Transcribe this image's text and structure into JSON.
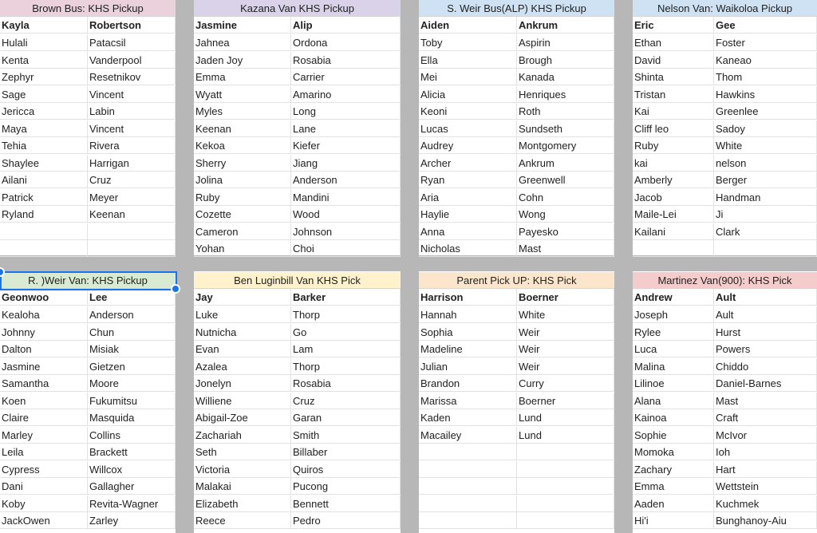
{
  "blocks": [
    {
      "id": "brown-bus",
      "title": "Brown Bus: KHS Pickup",
      "color": "#ead1dc",
      "head": [
        "Kayla",
        "Robertson"
      ],
      "rows": [
        [
          "Hulali",
          "Patacsil"
        ],
        [
          "Kenta",
          "Vanderpool"
        ],
        [
          "Zephyr",
          "Resetnikov"
        ],
        [
          "Sage",
          "Vincent"
        ],
        [
          "Jericca",
          "Labin"
        ],
        [
          "Maya",
          "Vincent"
        ],
        [
          "Tehia",
          "Rivera"
        ],
        [
          "Shaylee",
          "Harrigan"
        ],
        [
          "Ailani",
          "Cruz"
        ],
        [
          "Patrick",
          "Meyer"
        ],
        [
          "Ryland",
          "Keenan"
        ],
        [
          "",
          ""
        ],
        [
          "",
          ""
        ]
      ]
    },
    {
      "id": "kazana-van",
      "title": "Kazana Van KHS Pickup",
      "color": "#d9d2e9",
      "head": [
        "Jasmine",
        "Alip"
      ],
      "rows": [
        [
          "Jahnea",
          "Ordona"
        ],
        [
          "Jaden Joy",
          "Rosabia"
        ],
        [
          "Emma",
          "Carrier"
        ],
        [
          "Wyatt",
          "Amarino"
        ],
        [
          "Myles",
          "Long"
        ],
        [
          "Keenan",
          "Lane"
        ],
        [
          "Kekoa",
          "Kiefer"
        ],
        [
          "Sherry",
          "Jiang"
        ],
        [
          "Jolina",
          "Anderson"
        ],
        [
          "Ruby",
          "Mandini"
        ],
        [
          "Cozette",
          "Wood"
        ],
        [
          "Cameron",
          "Johnson"
        ],
        [
          "Yohan",
          "Choi"
        ]
      ]
    },
    {
      "id": "weir-bus",
      "title": "S. Weir Bus(ALP) KHS Pickup",
      "color": "#cfe2f3",
      "head": [
        "Aiden",
        "Ankrum"
      ],
      "rows": [
        [
          "Toby",
          "Aspirin"
        ],
        [
          "Ella",
          "Brough"
        ],
        [
          "Mei",
          "Kanada"
        ],
        [
          "Alicia",
          "Henriques"
        ],
        [
          "Keoni",
          "Roth"
        ],
        [
          "Lucas",
          "Sundseth"
        ],
        [
          "Audrey",
          "Montgomery"
        ],
        [
          "Archer",
          "Ankrum"
        ],
        [
          "Ryan",
          "Greenwell"
        ],
        [
          "Aria",
          "Cohn"
        ],
        [
          "Haylie",
          "Wong"
        ],
        [
          "Anna",
          "Payesko"
        ],
        [
          "Nicholas",
          "Mast"
        ]
      ]
    },
    {
      "id": "nelson-van",
      "title": "Nelson Van: Waikoloa Pickup",
      "color": "#cfe2f3",
      "head": [
        "Eric",
        "Gee"
      ],
      "rows": [
        [
          "Ethan",
          "Foster"
        ],
        [
          "David",
          "Kaneao"
        ],
        [
          "Shinta",
          "Thom"
        ],
        [
          "Tristan",
          "Hawkins"
        ],
        [
          "Kai",
          "Greenlee"
        ],
        [
          "Cliff leo",
          "Sadoy"
        ],
        [
          "Ruby",
          "White"
        ],
        [
          "kai",
          "nelson"
        ],
        [
          "Amberly",
          "Berger"
        ],
        [
          "Jacob",
          "Handman"
        ],
        [
          "Maile-Lei",
          "Ji"
        ],
        [
          "Kailani",
          "Clark"
        ],
        [
          "",
          ""
        ]
      ]
    },
    {
      "id": "r-weir-van",
      "title": "R. )Weir Van: KHS Pickup",
      "color": "#d9ead3",
      "head": [
        "Geonwoo",
        "Lee"
      ],
      "rows": [
        [
          "Kealoha",
          "Anderson"
        ],
        [
          "Johnny",
          "Chun"
        ],
        [
          "Dalton",
          "Misiak"
        ],
        [
          "Jasmine",
          "Gietzen"
        ],
        [
          "Samantha",
          "Moore"
        ],
        [
          "Koen",
          "Fukumitsu"
        ],
        [
          "Claire",
          "Masquida"
        ],
        [
          "Marley",
          "Collins"
        ],
        [
          "Leila",
          "Brackett"
        ],
        [
          "Cypress",
          "Willcox"
        ],
        [
          "Dani",
          "Gallagher"
        ],
        [
          "Koby",
          "Revita-Wagner"
        ],
        [
          "JackOwen",
          "Zarley"
        ]
      ]
    },
    {
      "id": "luginbill-van",
      "title": "Ben Luginbill Van KHS Pick",
      "color": "#fff2cc",
      "head": [
        "Jay",
        "Barker"
      ],
      "rows": [
        [
          "Luke",
          "Thorp"
        ],
        [
          "Nutnicha",
          "Go"
        ],
        [
          "Evan",
          "Lam"
        ],
        [
          "Azalea",
          "Thorp"
        ],
        [
          "Jonelyn",
          "Rosabia"
        ],
        [
          "Williene",
          "Cruz"
        ],
        [
          "Abigail-Zoe",
          "Garan"
        ],
        [
          "Zachariah",
          "Smith"
        ],
        [
          "Seth",
          "Billaber"
        ],
        [
          "Victoria",
          "Quiros"
        ],
        [
          "Malakai",
          "Pucong"
        ],
        [
          "Elizabeth",
          "Bennett"
        ],
        [
          "Reece",
          "Pedro"
        ]
      ]
    },
    {
      "id": "parent-pickup",
      "title": "Parent Pick UP: KHS Pick",
      "color": "#fce5cd",
      "head": [
        "Harrison",
        "Boerner"
      ],
      "rows": [
        [
          "Hannah",
          "White"
        ],
        [
          "Sophia",
          "Weir"
        ],
        [
          "Madeline",
          "Weir"
        ],
        [
          "Julian",
          "Weir"
        ],
        [
          "Brandon",
          "Curry"
        ],
        [
          "Marissa",
          "Boerner"
        ],
        [
          "Kaden",
          "Lund"
        ],
        [
          "Macailey",
          "Lund"
        ],
        [
          "",
          ""
        ],
        [
          "",
          ""
        ],
        [
          "",
          ""
        ],
        [
          "",
          ""
        ],
        [
          "",
          ""
        ]
      ]
    },
    {
      "id": "martinez-van",
      "title": "Martinez Van(900): KHS Pick",
      "color": "#f4cccc",
      "head": [
        "Andrew",
        "Ault"
      ],
      "rows": [
        [
          "Joseph",
          "Ault"
        ],
        [
          "Rylee",
          "Hurst"
        ],
        [
          "Luca",
          "Powers"
        ],
        [
          "Malina",
          "Chiddo"
        ],
        [
          "Lilinoe",
          "Daniel-Barnes"
        ],
        [
          "Alana",
          "Mast"
        ],
        [
          "Kainoa",
          "Craft"
        ],
        [
          "Sophie",
          "McIvor"
        ],
        [
          "Momoka",
          "Ioh"
        ],
        [
          "Zachary",
          "Hart"
        ],
        [
          "Emma",
          "Wettstein"
        ],
        [
          "Aaden",
          "Kuchmek"
        ],
        [
          "Hi'i",
          "Bunghanoy-Aiu"
        ]
      ]
    }
  ]
}
